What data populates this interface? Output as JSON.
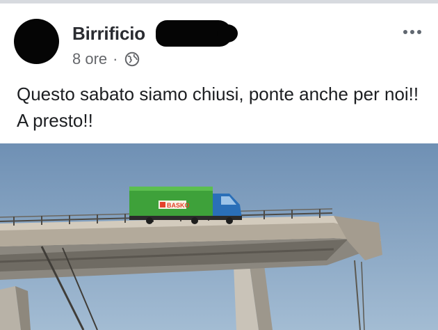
{
  "post": {
    "author": "Birrificio",
    "time": "8 ore",
    "separator": "·",
    "privacy_icon": "globe-icon",
    "menu_icon": "more-options-icon",
    "text": "Questo sabato siamo chiusi, ponte anche per noi!! A presto!!"
  },
  "image": {
    "truck_brand": "BASKO"
  },
  "colors": {
    "sky": "#7f9fbf",
    "truck_cargo": "#3ea13a",
    "truck_cab": "#2a6fb8",
    "text": "#1c1e21",
    "meta": "#65676b"
  }
}
